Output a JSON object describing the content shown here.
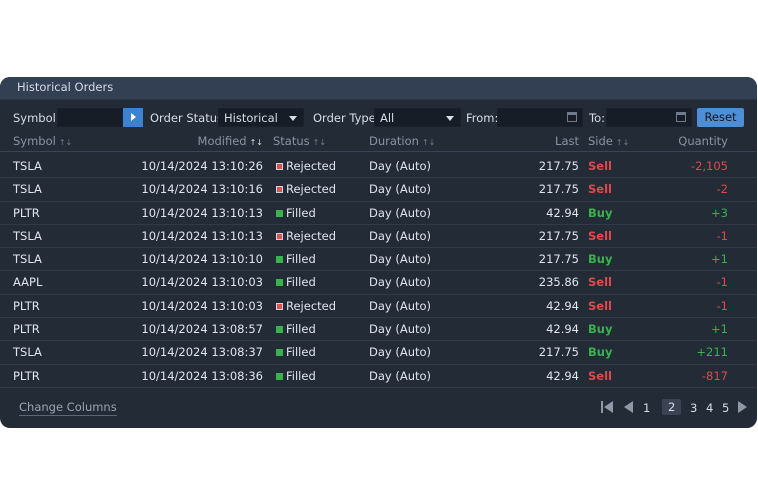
{
  "panel": {
    "title": "Historical Orders"
  },
  "filters": {
    "symbol_label": "Symbol",
    "symbol_value": "",
    "order_status_label": "Order Status",
    "order_status_value": "Historical",
    "order_type_label": "Order Type",
    "order_type_value": "All",
    "from_label": "From:",
    "from_value": "",
    "to_label": "To:",
    "to_value": "",
    "reset_label": "Reset"
  },
  "columns": {
    "symbol": "Symbol",
    "modified": "Modified",
    "status": "Status",
    "duration": "Duration",
    "last": "Last",
    "side": "Side",
    "quantity": "Quantity"
  },
  "rows": [
    {
      "symbol": "TSLA",
      "modified": "10/14/2024 13:10:26",
      "status": "Rejected",
      "duration": "Day (Auto)",
      "last": "217.75",
      "side": "Sell",
      "quantity": "-2,105"
    },
    {
      "symbol": "TSLA",
      "modified": "10/14/2024 13:10:16",
      "status": "Rejected",
      "duration": "Day (Auto)",
      "last": "217.75",
      "side": "Sell",
      "quantity": "-2"
    },
    {
      "symbol": "PLTR",
      "modified": "10/14/2024 13:10:13",
      "status": "Filled",
      "duration": "Day (Auto)",
      "last": "42.94",
      "side": "Buy",
      "quantity": "+3"
    },
    {
      "symbol": "TSLA",
      "modified": "10/14/2024 13:10:13",
      "status": "Rejected",
      "duration": "Day (Auto)",
      "last": "217.75",
      "side": "Sell",
      "quantity": "-1"
    },
    {
      "symbol": "TSLA",
      "modified": "10/14/2024 13:10:10",
      "status": "Filled",
      "duration": "Day (Auto)",
      "last": "217.75",
      "side": "Buy",
      "quantity": "+1"
    },
    {
      "symbol": "AAPL",
      "modified": "10/14/2024 13:10:03",
      "status": "Filled",
      "duration": "Day (Auto)",
      "last": "235.86",
      "side": "Sell",
      "quantity": "-1"
    },
    {
      "symbol": "PLTR",
      "modified": "10/14/2024 13:10:03",
      "status": "Rejected",
      "duration": "Day (Auto)",
      "last": "42.94",
      "side": "Sell",
      "quantity": "-1"
    },
    {
      "symbol": "PLTR",
      "modified": "10/14/2024 13:08:57",
      "status": "Filled",
      "duration": "Day (Auto)",
      "last": "42.94",
      "side": "Buy",
      "quantity": "+1"
    },
    {
      "symbol": "TSLA",
      "modified": "10/14/2024 13:08:37",
      "status": "Filled",
      "duration": "Day (Auto)",
      "last": "217.75",
      "side": "Buy",
      "quantity": "+211"
    },
    {
      "symbol": "PLTR",
      "modified": "10/14/2024 13:08:36",
      "status": "Filled",
      "duration": "Day (Auto)",
      "last": "42.94",
      "side": "Sell",
      "quantity": "-817"
    }
  ],
  "footer": {
    "change_columns": "Change Columns",
    "pages": [
      "1",
      "2",
      "3",
      "4",
      "5"
    ],
    "current_page": "2"
  },
  "colors": {
    "panel_bg": "#232b37",
    "sell": "#e0484b",
    "buy": "#37b34a",
    "accent": "#4d8fd6"
  },
  "icons": {
    "symbol_go": "play-arrow-icon",
    "dropdown": "chevron-down-icon",
    "date": "calendar-icon",
    "sort": "sort-arrows-icon",
    "status_filled": "filled-square-icon",
    "status_rejected": "rejected-square-icon",
    "pager_first": "first-page-icon",
    "pager_prev": "prev-page-icon",
    "pager_next": "next-page-icon"
  }
}
